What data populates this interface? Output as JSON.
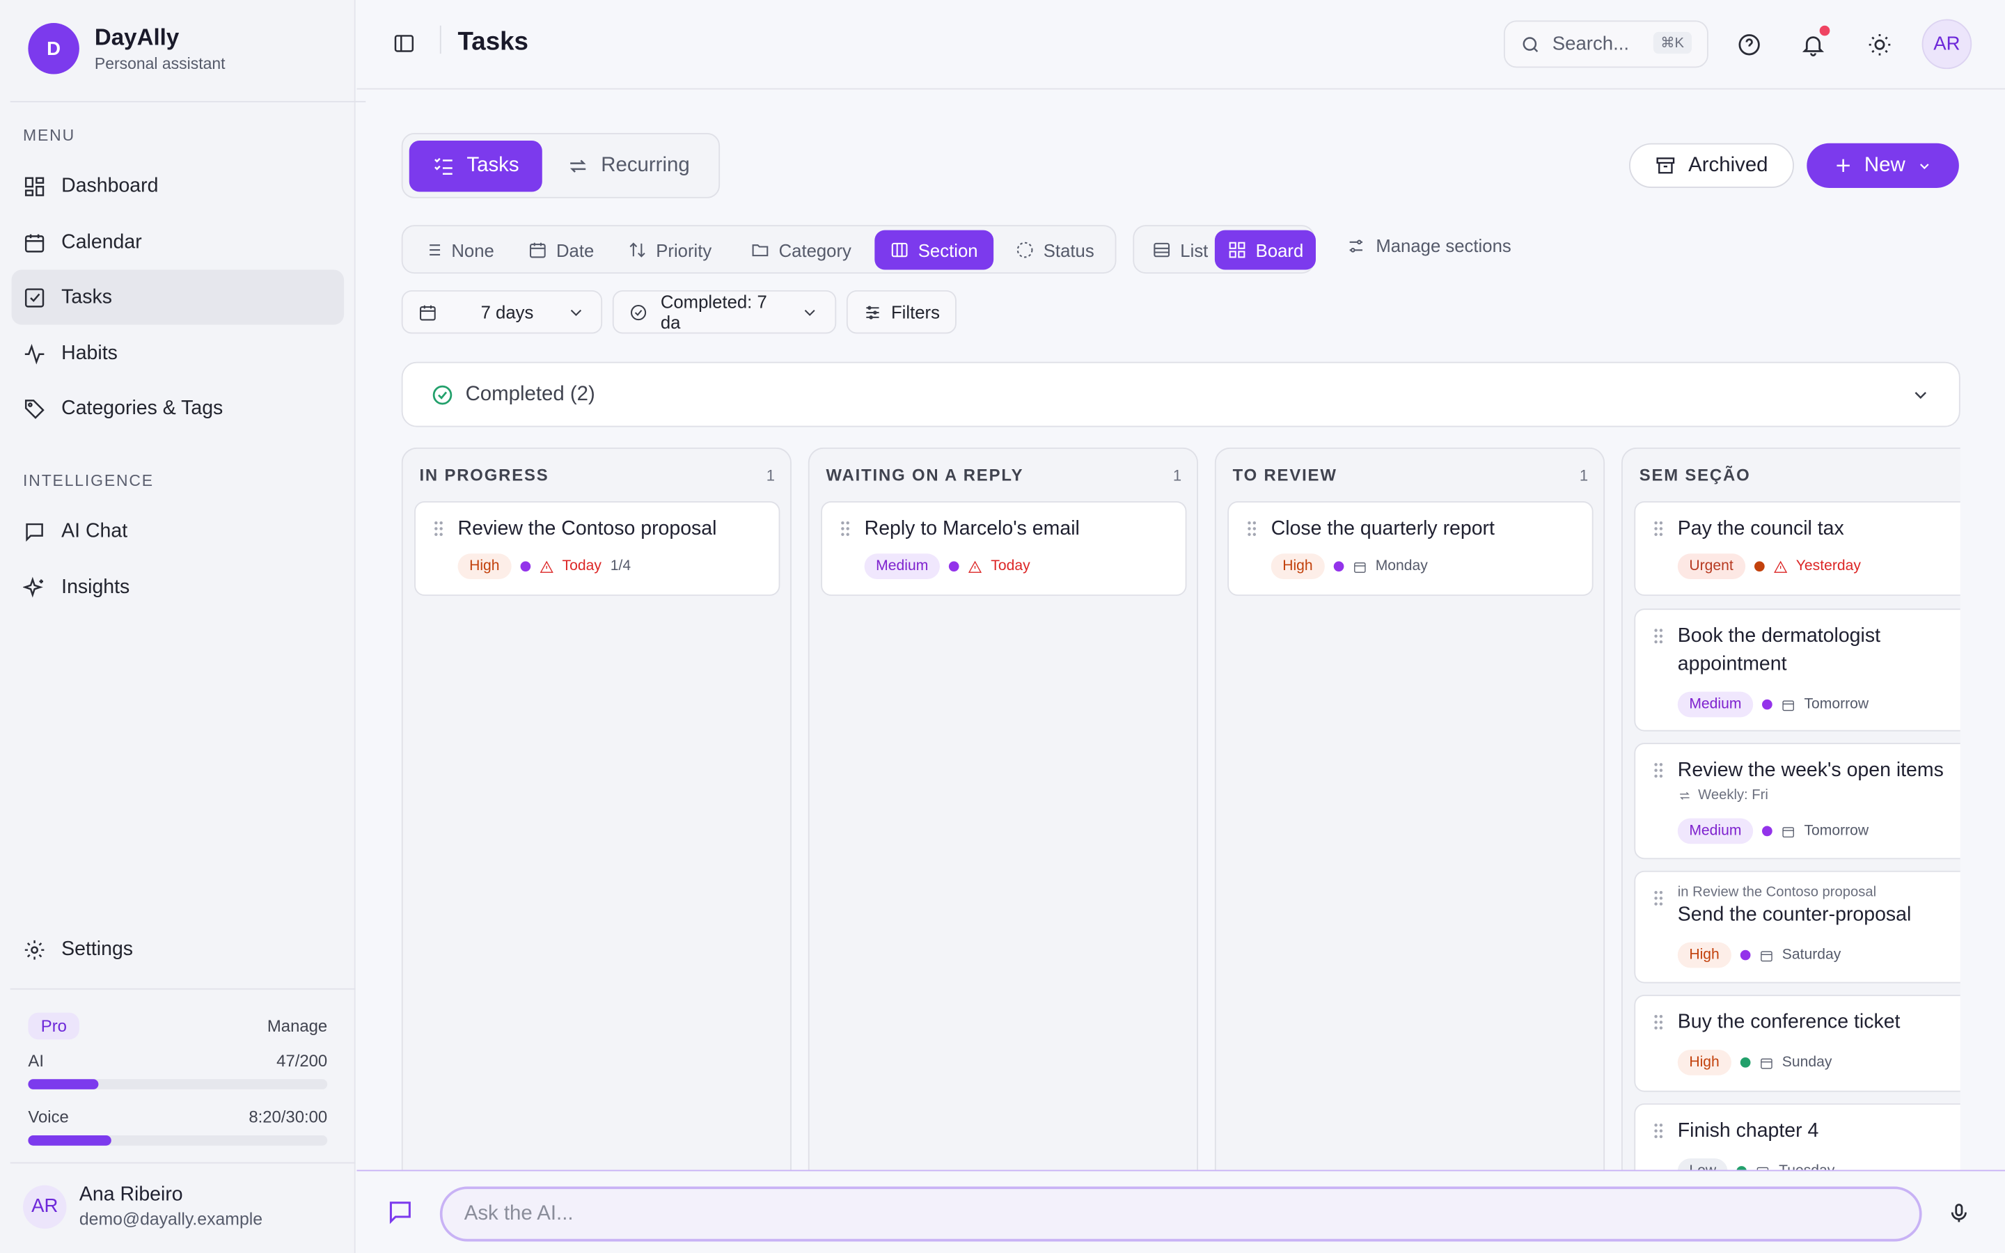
{
  "brand": {
    "logo_letter": "D",
    "name": "DayAlly",
    "subtitle": "Personal assistant"
  },
  "sidebar": {
    "menu_label": "MENU",
    "menu": [
      {
        "label": "Dashboard",
        "icon": "dashboard-icon"
      },
      {
        "label": "Calendar",
        "icon": "calendar-icon"
      },
      {
        "label": "Tasks",
        "icon": "tasks-icon",
        "active": true
      },
      {
        "label": "Habits",
        "icon": "activity-icon"
      },
      {
        "label": "Categories & Tags",
        "icon": "tag-icon"
      }
    ],
    "intelligence_label": "INTELLIGENCE",
    "intelligence": [
      {
        "label": "AI Chat",
        "icon": "chat-icon"
      },
      {
        "label": "Insights",
        "icon": "sparkles-icon"
      }
    ],
    "settings_label": "Settings",
    "plan": {
      "badge": "Pro",
      "manage": "Manage",
      "ai_label": "AI",
      "ai_value": "47/200",
      "ai_fraction": 0.235,
      "voice_label": "Voice",
      "voice_value": "8:20/30:00",
      "voice_fraction": 0.278
    },
    "user": {
      "initials": "AR",
      "name": "Ana Ribeiro",
      "email": "demo@dayally.example"
    }
  },
  "header": {
    "title": "Tasks",
    "search_placeholder": "Search...",
    "search_shortcut": "⌘K",
    "avatar_initials": "AR"
  },
  "tabs": {
    "tasks": "Tasks",
    "recurring": "Recurring"
  },
  "actions": {
    "archived": "Archived",
    "new": "New"
  },
  "group_by": {
    "none": "None",
    "date": "Date",
    "priority": "Priority",
    "category": "Category",
    "section": "Section",
    "status": "Status",
    "selected": "Section"
  },
  "view": {
    "list": "List",
    "board": "Board",
    "selected": "Board"
  },
  "manage_sections": "Manage sections",
  "filters": {
    "range": "7 days",
    "completed": "Completed: 7 da",
    "filters": "Filters"
  },
  "completed_group": "Completed (2)",
  "colors": {
    "accent": "#7c3aed",
    "high": "#c2410c",
    "urgent": "#b73a21",
    "overdue": "#dc2626"
  },
  "columns": [
    {
      "title": "IN PROGRESS",
      "count": "1",
      "cards": [
        {
          "title": "Review the Contoso proposal",
          "priority": "High",
          "dot": "#9333ea",
          "date": "Today",
          "overdue": true,
          "extra": "1/4"
        }
      ]
    },
    {
      "title": "WAITING ON A REPLY",
      "count": "1",
      "cards": [
        {
          "title": "Reply to Marcelo's email",
          "priority": "Medium",
          "dot": "#9333ea",
          "date": "Today",
          "overdue": true
        }
      ]
    },
    {
      "title": "TO REVIEW",
      "count": "1",
      "cards": [
        {
          "title": "Close the quarterly report",
          "priority": "High",
          "dot": "#9333ea",
          "date": "Monday"
        }
      ]
    },
    {
      "title": "SEM SEÇÃO",
      "count": "",
      "cards": [
        {
          "title": "Pay the council tax",
          "priority": "Urgent",
          "dot": "#c2410c",
          "date": "Yesterday",
          "overdue": true
        },
        {
          "title": "Book the dermatologist appointment",
          "priority": "Medium",
          "dot": "#9333ea",
          "date": "Tomorrow"
        },
        {
          "title": "Review the week's open items",
          "recurrence": "Weekly: Fri",
          "priority": "Medium",
          "dot": "#9333ea",
          "date": "Tomorrow"
        },
        {
          "parent": "in Review the Contoso proposal",
          "title": "Send the counter-proposal",
          "priority": "High",
          "dot": "#9333ea",
          "date": "Saturday"
        },
        {
          "title": "Buy the conference ticket",
          "priority": "High",
          "dot": "#22a06b",
          "date": "Sunday"
        },
        {
          "title": "Finish chapter 4",
          "priority": "Low",
          "dot": "#22a06b",
          "date": "Tuesday"
        }
      ]
    }
  ],
  "ask_ai": {
    "placeholder": "Ask the AI..."
  }
}
